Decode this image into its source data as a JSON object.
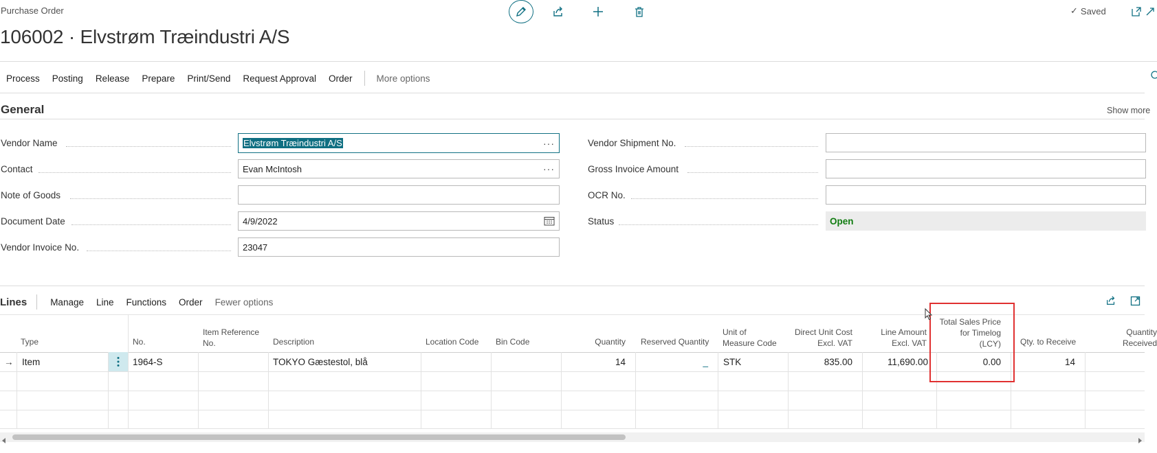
{
  "header": {
    "caption": "Purchase Order",
    "title": "106002 · Elvstrøm Træindustri A/S",
    "saved_label": "Saved",
    "saved_check": "✓"
  },
  "actions": {
    "items": [
      "Process",
      "Posting",
      "Release",
      "Prepare",
      "Print/Send",
      "Request Approval",
      "Order"
    ],
    "more": "More options"
  },
  "general": {
    "title": "General",
    "show_more": "Show more",
    "left_fields": [
      {
        "label": "Vendor Name",
        "value": "Elvstrøm Træindustri A/S"
      },
      {
        "label": "Contact",
        "value": "Evan McIntosh"
      },
      {
        "label": "Note of Goods",
        "value": ""
      },
      {
        "label": "Document Date",
        "value": "4/9/2022"
      },
      {
        "label": "Vendor Invoice No.",
        "value": "23047"
      }
    ],
    "right_fields": [
      {
        "label": "Vendor Shipment No.",
        "value": ""
      },
      {
        "label": "Gross Invoice Amount",
        "value": ""
      },
      {
        "label": "OCR No.",
        "value": ""
      },
      {
        "label": "Status",
        "value": "Open"
      }
    ],
    "ellipsis": "···"
  },
  "lines": {
    "title": "Lines",
    "menu": [
      "Manage",
      "Line",
      "Functions",
      "Order"
    ],
    "fewer": "Fewer options",
    "columns": {
      "type": "Type",
      "no": "No.",
      "item_ref": [
        "Item Reference",
        "No."
      ],
      "description": "Description",
      "location": "Location Code",
      "bin": "Bin Code",
      "quantity": "Quantity",
      "reserved": "Reserved Quantity",
      "uom": [
        "Unit of",
        "Measure Code"
      ],
      "direct_cost": [
        "Direct Unit Cost",
        "Excl. VAT"
      ],
      "line_amount": [
        "Line Amount",
        "Excl. VAT"
      ],
      "total_sales": [
        "Total Sales Price",
        "for Timelog",
        "(LCY)"
      ],
      "qty_receive": "Qty. to Receive",
      "qty_received": [
        "Quantity",
        "Received"
      ]
    },
    "row": {
      "arrow": "→",
      "type": "Item",
      "no": "1964-S",
      "description": "TOKYO Gæstestol, blå",
      "quantity": "14",
      "reserved": "_",
      "uom": "STK",
      "direct_cost": "835.00",
      "line_amount": "11,690.00",
      "total_sales": "0.00",
      "qty_receive": "14"
    }
  },
  "colors": {
    "accent": "#0f6f82",
    "status_open": "#107c10",
    "highlight": "#e03030"
  }
}
